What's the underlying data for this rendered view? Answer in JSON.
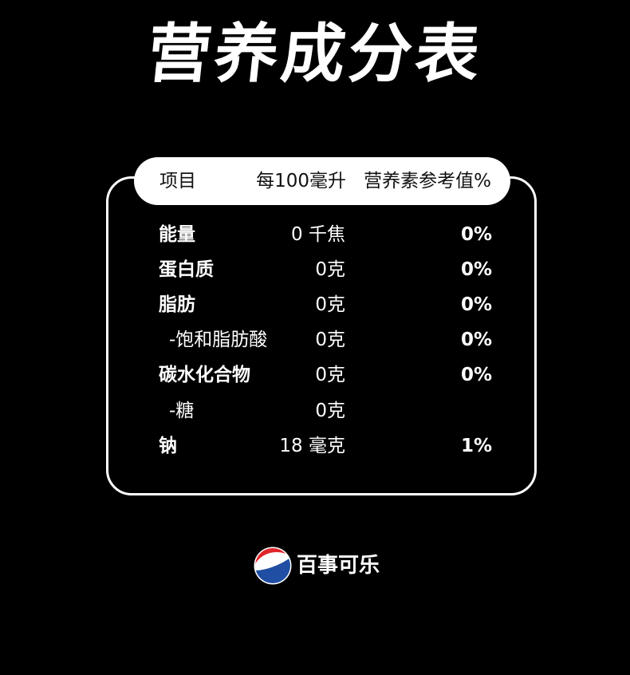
{
  "title": "营养成分表",
  "table": {
    "headers": {
      "item": "项目",
      "per_100ml": "每100毫升",
      "nrv": "营养素参考值%"
    },
    "rows": [
      {
        "name": "能量",
        "amount": "0 千焦",
        "nrv": "0%",
        "sub": false
      },
      {
        "name": "蛋白质",
        "amount": "0克",
        "nrv": "0%",
        "sub": false
      },
      {
        "name": "脂肪",
        "amount": "0克",
        "nrv": "0%",
        "sub": false
      },
      {
        "name": "-饱和脂肪酸",
        "amount": "0克",
        "nrv": "0%",
        "sub": true
      },
      {
        "name": "碳水化合物",
        "amount": "0克",
        "nrv": "0%",
        "sub": false
      },
      {
        "name": "-糖",
        "amount": "0克",
        "nrv": "",
        "sub": true
      },
      {
        "name": "钠",
        "amount": "18 毫克",
        "nrv": "1%",
        "sub": false
      }
    ]
  },
  "brand": {
    "name": "百事可乐",
    "logo_icon": "pepsi-globe-icon",
    "colors": {
      "red": "#e0262b",
      "blue": "#1f4ea3",
      "white": "#ffffff"
    }
  },
  "colors": {
    "background": "#000000",
    "foreground": "#ffffff",
    "header_text": "#111111"
  }
}
